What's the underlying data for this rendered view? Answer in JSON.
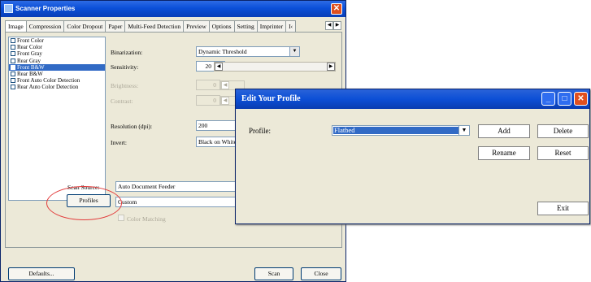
{
  "scanner_window": {
    "title": "Scanner Properties",
    "tabs": [
      "Image",
      "Compression",
      "Color Dropout",
      "Paper",
      "Multi-Feed Detection",
      "Preview",
      "Options",
      "Setting",
      "Imprinter",
      "I‹"
    ],
    "image_types": [
      {
        "label": "Front Color",
        "checked": false,
        "selected": false
      },
      {
        "label": "Rear Color",
        "checked": false,
        "selected": false
      },
      {
        "label": "Front Gray",
        "checked": false,
        "selected": false
      },
      {
        "label": "Rear Gray",
        "checked": false,
        "selected": false
      },
      {
        "label": "Front B&W",
        "checked": true,
        "selected": true
      },
      {
        "label": "Rear B&W",
        "checked": false,
        "selected": false
      },
      {
        "label": "Front Auto Color Detection",
        "checked": false,
        "selected": false
      },
      {
        "label": "Rear Auto Color Detection",
        "checked": false,
        "selected": false
      }
    ],
    "binarization_label": "Binarization:",
    "binarization_value": "Dynamic Threshold",
    "sensitivity_label": "Sensitivity:",
    "sensitivity_value": "20",
    "brightness_label": "Brightness:",
    "brightness_value": "0",
    "contrast_label": "Contrast:",
    "contrast_value": "0",
    "resolution_label": "Resolution (dpi):",
    "resolution_value": "200",
    "invert_label": "Invert:",
    "invert_value": "Black on White",
    "scan_source_label": "Scan Source:",
    "scan_source_value": "Auto Document Feeder",
    "profiles_button": "Profiles",
    "profile_value": "Custom",
    "color_matching_label": "Color Matching",
    "defaults_button": "Defaults...",
    "scan_button": "Scan",
    "close_button": "Close"
  },
  "profile_dialog": {
    "title": "Edit Your Profile",
    "profile_label": "Profile:",
    "profile_value": "Flatbed",
    "add_button": "Add",
    "delete_button": "Delete",
    "rename_button": "Rename",
    "reset_button": "Reset",
    "exit_button": "Exit"
  },
  "colors": {
    "titlebar": "#0b4fd8",
    "selection": "#316ac5",
    "annotation": "#e23b3b",
    "window_bg": "#ece9d8"
  }
}
